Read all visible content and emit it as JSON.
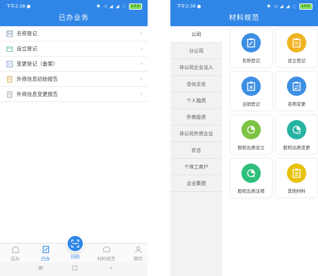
{
  "left_screen": {
    "status": {
      "time": "下午2:38",
      "battery": "100"
    },
    "title": "已办业务",
    "items": [
      {
        "label": "名称登记",
        "icon": "bookmark-icon"
      },
      {
        "label": "设立登记",
        "icon": "folder-icon"
      },
      {
        "label": "变更登记（备案）",
        "icon": "edit-icon"
      },
      {
        "label": "外商信息初始报告",
        "icon": "document-icon"
      },
      {
        "label": "外商信息变更报告",
        "icon": "document-icon"
      }
    ],
    "nav": {
      "items": [
        {
          "label": "在办",
          "icon": "inbox-icon"
        },
        {
          "label": "已办",
          "icon": "done-icon"
        },
        {
          "label": "材料规范",
          "icon": "box-icon"
        },
        {
          "label": "我的",
          "icon": "user-icon"
        }
      ],
      "scan_label": "扫码"
    },
    "system_keys": [
      "≡",
      "▢",
      "‹"
    ]
  },
  "right_screen": {
    "status": {
      "time": "下午2:38",
      "battery": "100"
    },
    "title": "材料规范",
    "categories": [
      "公司",
      "分公司",
      "非公司企业法人",
      "合伙企业",
      "个人独资",
      "外商投资",
      "非公司外资企业",
      "农合",
      "个体工商户",
      "企业集团"
    ],
    "active_category": "公司",
    "cards": [
      {
        "label": "名称登记",
        "icon": "clipboard-pen-icon",
        "color": "#3d8fe3"
      },
      {
        "label": "设立登记",
        "icon": "clipboard-icon",
        "color": "#f0b323"
      },
      {
        "label": "注销登记",
        "icon": "clipboard-cancel-icon",
        "color": "#3d8fe3"
      },
      {
        "label": "名称变更",
        "icon": "clipboard-swap-icon",
        "color": "#3d8fe3"
      },
      {
        "label": "股权出质设立",
        "icon": "pie-chart-icon",
        "color": "#7cc243"
      },
      {
        "label": "股权出质变更",
        "icon": "pie-chart-swap-icon",
        "color": "#27b3a2"
      },
      {
        "label": "股权出质注销",
        "icon": "pie-chart-cancel-icon",
        "color": "#2ec07a"
      },
      {
        "label": "其他材料",
        "icon": "clipboard-list-icon",
        "color": "#e8c20e"
      }
    ]
  },
  "colors": {
    "primary": "#2f86e6",
    "divider": "#ececec",
    "sidebar_bg": "#f2f2f2"
  }
}
